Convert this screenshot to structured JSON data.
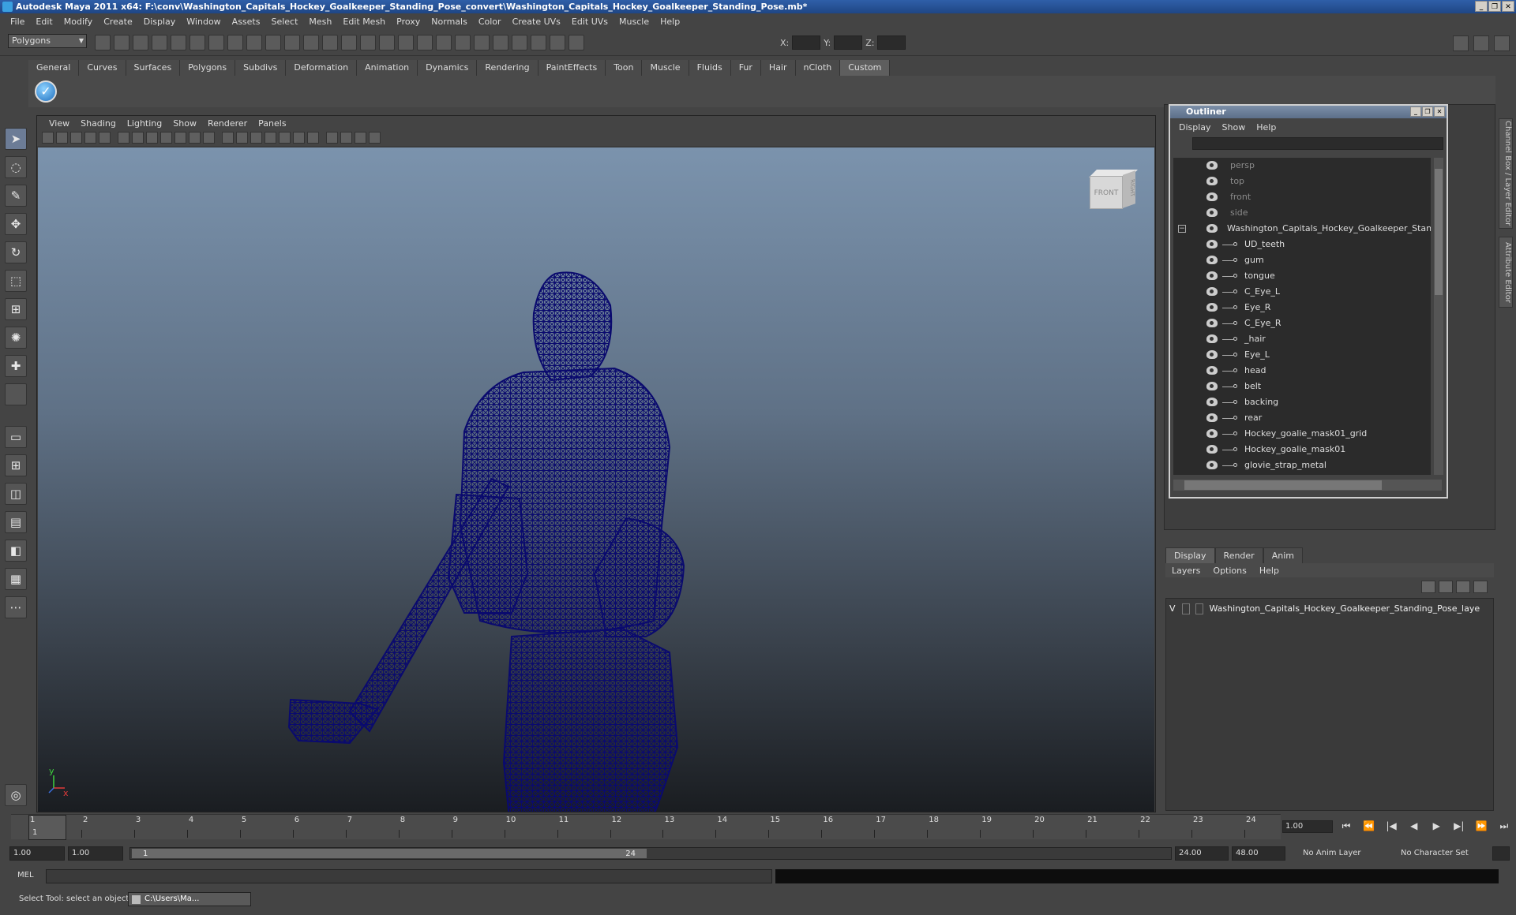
{
  "window": {
    "title": "Autodesk Maya 2011 x64: F:\\conv\\Washington_Capitals_Hockey_Goalkeeper_Standing_Pose_convert\\Washington_Capitals_Hockey_Goalkeeper_Standing_Pose.mb*",
    "controls": [
      "_",
      "❐",
      "✕"
    ]
  },
  "menubar": [
    "File",
    "Edit",
    "Modify",
    "Create",
    "Display",
    "Window",
    "Assets",
    "Select",
    "Mesh",
    "Edit Mesh",
    "Proxy",
    "Normals",
    "Color",
    "Create UVs",
    "Edit UVs",
    "Muscle",
    "Help"
  ],
  "statusline": {
    "mode": "Polygons",
    "x_label": "X:",
    "y_label": "Y:",
    "z_label": "Z:"
  },
  "shelf": {
    "tabs": [
      "General",
      "Curves",
      "Surfaces",
      "Polygons",
      "Subdivs",
      "Deformation",
      "Animation",
      "Dynamics",
      "Rendering",
      "PaintEffects",
      "Toon",
      "Muscle",
      "Fluids",
      "Fur",
      "Hair",
      "nCloth",
      "Custom"
    ],
    "active_tab": "Custom"
  },
  "viewport": {
    "menu": [
      "View",
      "Shading",
      "Lighting",
      "Show",
      "Renderer",
      "Panels"
    ],
    "viewcube_front": "FRONT",
    "viewcube_right": "RIGHT",
    "axis_y": "y",
    "axis_x": "x",
    "wire_color": "#0a0a6e"
  },
  "outliner": {
    "title": "Outliner",
    "menu": [
      "Display",
      "Show",
      "Help"
    ],
    "cameras": [
      "persp",
      "top",
      "front",
      "side"
    ],
    "group": "Washington_Capitals_Hockey_Goalkeeper_Standing_",
    "children": [
      "UD_teeth",
      "gum",
      "tongue",
      "C_Eye_L",
      "Eye_R",
      "C_Eye_R",
      "_hair",
      "Eye_L",
      "head",
      "belt",
      "backing",
      "rear",
      "Hockey_goalie_mask01_grid",
      "Hockey_goalie_mask01",
      "glovie_strap_metal"
    ]
  },
  "side_tabs": [
    "Channel Box / Layer Editor",
    "Attribute Editor"
  ],
  "layer_editor": {
    "tabs": [
      "Display",
      "Render",
      "Anim"
    ],
    "active_tab": "Display",
    "menu": [
      "Layers",
      "Options",
      "Help"
    ],
    "visible_flag": "V",
    "layer_name": "Washington_Capitals_Hockey_Goalkeeper_Standing_Pose_laye"
  },
  "timeline": {
    "ticks": [
      "1",
      "2",
      "3",
      "4",
      "5",
      "6",
      "7",
      "8",
      "9",
      "10",
      "11",
      "12",
      "13",
      "14",
      "15",
      "16",
      "17",
      "18",
      "19",
      "20",
      "21",
      "22",
      "23",
      "24"
    ],
    "current_frame_marker": "1",
    "current_time": "1.00",
    "playback_icons": [
      "⏮",
      "⏪",
      "|◀",
      "◀",
      "▶",
      "▶|",
      "⏩",
      "⏭"
    ]
  },
  "range": {
    "start_time": "1.00",
    "playback_start": "1.00",
    "range_start_label": "1",
    "range_end_label": "24",
    "playback_end": "24.00",
    "end_time": "48.00",
    "anim_layer": "No Anim Layer",
    "character_set": "No Character Set"
  },
  "commandline": {
    "label": "MEL"
  },
  "helpline": {
    "text": "Select Tool: select an object",
    "taskbar_item": "C:\\Users\\Ma..."
  }
}
